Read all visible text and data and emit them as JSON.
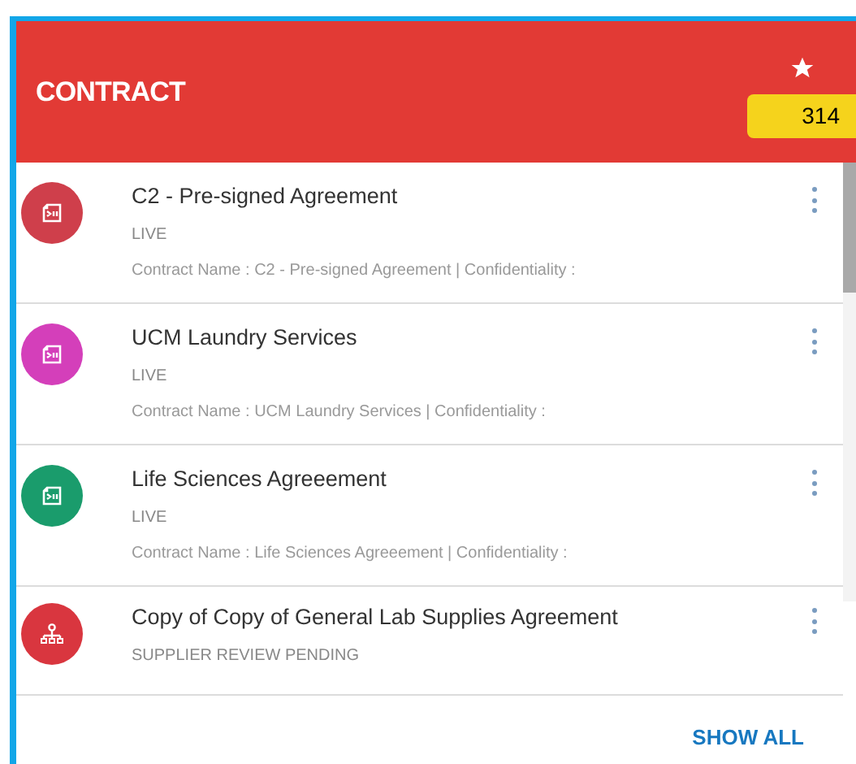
{
  "header": {
    "title": "CONTRACT",
    "count": "314"
  },
  "items": [
    {
      "kind": "document",
      "color": "#cf3f4b",
      "title": "C2 - Pre-signed Agreement",
      "status": "LIVE",
      "detail": "Contract Name : C2 - Pre-signed Agreement | Confidentiality :"
    },
    {
      "kind": "document",
      "color": "#d43fba",
      "title": "UCM Laundry Services",
      "status": "LIVE",
      "detail": "Contract Name : UCM Laundry Services | Confidentiality :"
    },
    {
      "kind": "document",
      "color": "#1a9c6c",
      "title": "Life Sciences Agreeement",
      "status": "LIVE",
      "detail": "Contract Name : Life Sciences Agreeement | Confidentiality :"
    },
    {
      "kind": "network",
      "color": "#d9363f",
      "title": "Copy of Copy of General Lab Supplies Agreement",
      "status": "SUPPLIER REVIEW PENDING"
    }
  ],
  "footer": {
    "link": "SHOW ALL"
  }
}
